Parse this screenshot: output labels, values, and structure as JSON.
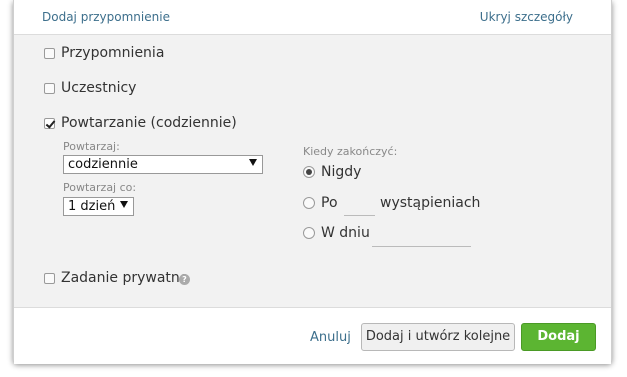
{
  "header": {
    "add_reminder": "Dodaj przypomnienie",
    "hide_details": "Ukryj szczegóły"
  },
  "options": {
    "reminders": {
      "label": "Przypomnienia",
      "checked": false
    },
    "participants": {
      "label": "Uczestnicy",
      "checked": false
    },
    "repeat": {
      "label": "Powtarzanie (codziennie)",
      "checked": true
    },
    "private": {
      "label": "Zadanie prywatne",
      "checked": false
    }
  },
  "repeat": {
    "repeat_label": "Powtarzaj:",
    "repeat_value": "codziennie",
    "every_label": "Powtarzaj co:",
    "every_value": "1 dzień"
  },
  "end": {
    "label": "Kiedy zakończyć:",
    "never": "Nigdy",
    "after_prefix": "Po",
    "after_suffix": "wystąpieniach",
    "on_date": "W dniu",
    "selected": "never"
  },
  "footer": {
    "cancel": "Anuluj",
    "add_and_new": "Dodaj i utwórz kolejne",
    "add": "Dodaj"
  },
  "colors": {
    "link": "#3d6f8c",
    "primary_button": "#5cb532",
    "background": "#f2f2f2"
  },
  "icons": {
    "help": "question-circle-icon",
    "select_arrow": "triangle-down-icon"
  }
}
